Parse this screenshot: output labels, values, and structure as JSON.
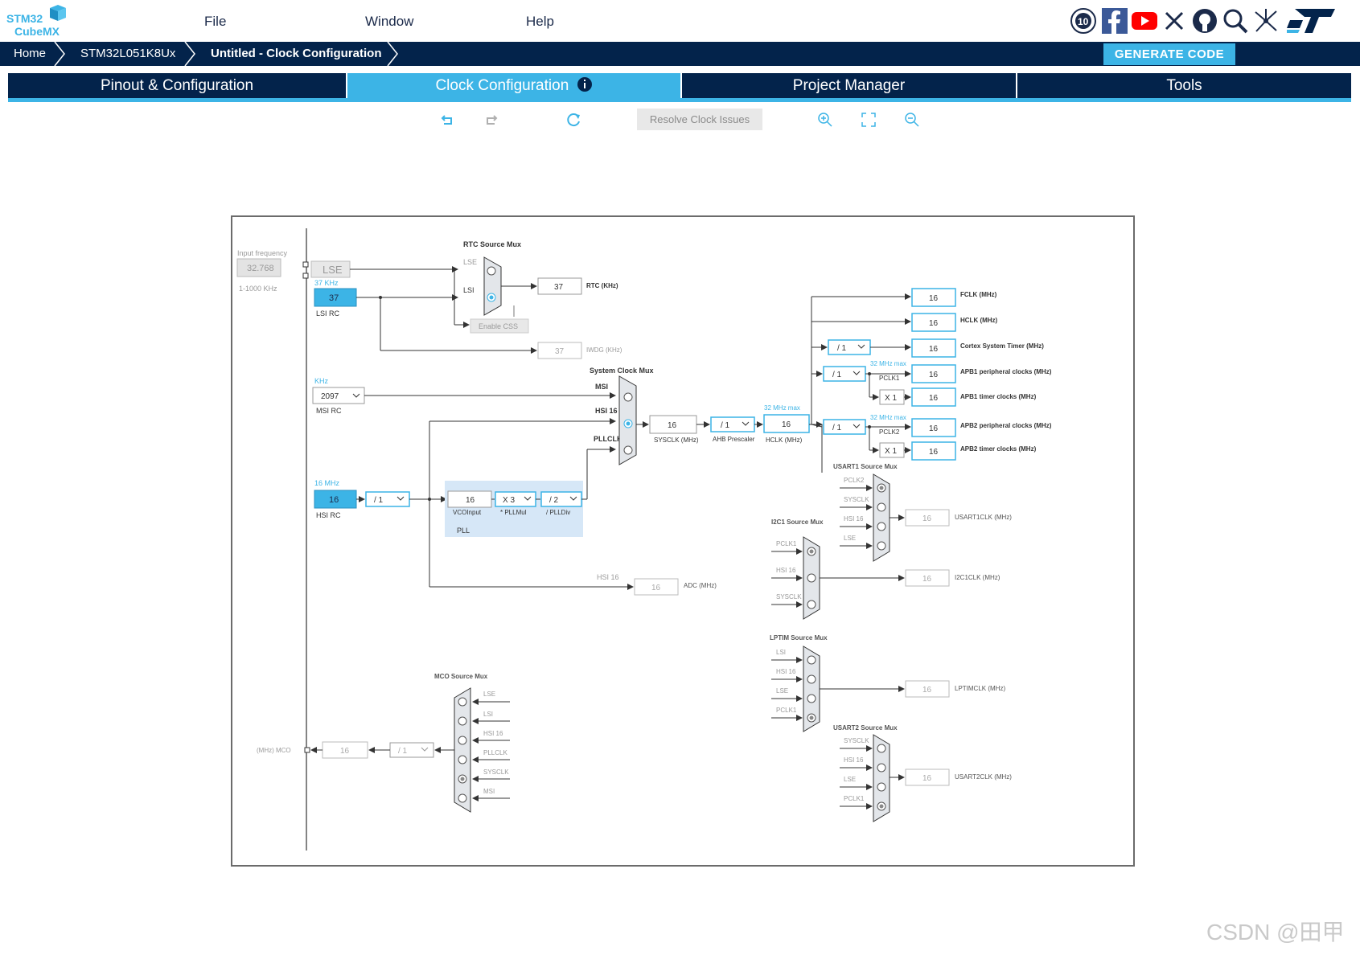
{
  "app": {
    "logo_line1": "STM32",
    "logo_line2": "CubeMX",
    "menu": [
      "File",
      "Window",
      "Help"
    ],
    "social_icons": [
      "anniversary-10-icon",
      "facebook-icon",
      "youtube-icon",
      "x-icon",
      "github-icon",
      "community-search-icon",
      "network-icon",
      "st-logo-icon"
    ],
    "accent_color": "#3cb4e6",
    "navy_color": "#03234b"
  },
  "breadcrumb": [
    "Home",
    "STM32L051K8Ux",
    "Untitled - Clock Configuration"
  ],
  "generate_code": "GENERATE CODE",
  "tabs": [
    "Pinout & Configuration",
    "Clock Configuration",
    "Project Manager",
    "Tools"
  ],
  "active_tab": "Clock Configuration",
  "toolbar": {
    "resolve": "Resolve Clock Issues",
    "icons": [
      "undo-icon",
      "redo-icon",
      "refresh-icon",
      "zoom-in-icon",
      "fit-screen-icon",
      "zoom-out-icon"
    ]
  },
  "clock": {
    "input_frequency_label": "Input frequency",
    "lse_value": "32.768",
    "lse_range": "1-1000 KHz",
    "lse_label": "LSE",
    "lsi_freq_label": "37 KHz",
    "lsi_value": "37",
    "lsi_rc": "LSI RC",
    "rtc_mux": "RTC Source Mux",
    "rtc_lse": "LSE",
    "rtc_lsi": "LSI",
    "rtc_value": "37",
    "rtc_label": "RTC (KHz)",
    "enable_css": "Enable CSS",
    "iwdg_value": "37",
    "iwdg_label": "IWDG (KHz)",
    "sysmux": "System Clock Mux",
    "khz": "KHz",
    "msi_value": "2097",
    "msi_rc": "MSI RC",
    "msi": "MSI",
    "hsi16": "HSI 16",
    "pllclk": "PLLCLK",
    "sysclk_value": "16",
    "sysclk_label": "SYSCLK (MHz)",
    "ahb_value": "/ 1",
    "ahb_label": "AHB Prescaler",
    "hclk_max": "32 MHz max",
    "hclk_value": "16",
    "hclk_label": "HCLK (MHz)",
    "hsi_freq": "16 MHz",
    "hsi_value": "16",
    "hsi_rc": "HSI RC",
    "hsi_div": "/ 1",
    "vco_value": "16",
    "vco_label": "VCOInput",
    "pllmul_value": "X 3",
    "pllmul_label": "* PLLMul",
    "plldiv_value": "/ 2",
    "plldiv_label": "/ PLLDiv",
    "pll": "PLL",
    "adc_hsi": "HSI 16",
    "adc_value": "16",
    "adc_label": "ADC (MHz)",
    "fclk_value": "16",
    "fclk_label": "FCLK (MHz)",
    "hclk2_value": "16",
    "hclk2_label": "HCLK (MHz)",
    "cortex_div": "/ 1",
    "cortex_value": "16",
    "cortex_label": "Cortex System Timer (MHz)",
    "apb1_max": "32 MHz max",
    "apb1_div": "/ 1",
    "pclk1": "PCLK1",
    "apb1_value": "16",
    "apb1_label": "APB1 peripheral clocks (MHz)",
    "apb1_x": "X 1",
    "apb1t_value": "16",
    "apb1t_label": "APB1 timer clocks (MHz)",
    "apb2_max": "32 MHz max",
    "apb2_div": "/ 1",
    "pclk2": "PCLK2",
    "apb2_value": "16",
    "apb2_label": "APB2 peripheral clocks (MHz)",
    "apb2_x": "X 1",
    "apb2t_value": "16",
    "apb2t_label": "APB2 timer clocks (MHz)",
    "usart1_mux": "USART1 Source Mux",
    "usart1_inputs": [
      "PCLK2",
      "SYSCLK",
      "HSI 16",
      "LSE"
    ],
    "usart1_value": "16",
    "usart1_label": "USART1CLK (MHz)",
    "i2c1_mux": "I2C1 Source Mux",
    "i2c1_inputs": [
      "PCLK1",
      "HSI 16",
      "SYSCLK"
    ],
    "i2c1_value": "16",
    "i2c1_label": "I2C1CLK (MHz)",
    "lptim_mux": "LPTIM Source Mux",
    "lptim_inputs": [
      "LSI",
      "HSI 16",
      "LSE",
      "PCLK1"
    ],
    "lptim_value": "16",
    "lptim_label": "LPTIMCLK (MHz)",
    "usart2_mux": "USART2 Source Mux",
    "usart2_inputs": [
      "SYSCLK",
      "HSI 16",
      "LSE",
      "PCLK1"
    ],
    "usart2_value": "16",
    "usart2_label": "USART2CLK (MHz)",
    "mco_mux": "MCO Source Mux",
    "mco_inputs": [
      "LSE",
      "LSI",
      "HSI 16",
      "PLLCLK",
      "SYSCLK",
      "MSI"
    ],
    "mco_div": "/ 1",
    "mco_value": "16",
    "mco_label": "(MHz) MCO"
  },
  "watermark": "CSDN @田甲"
}
